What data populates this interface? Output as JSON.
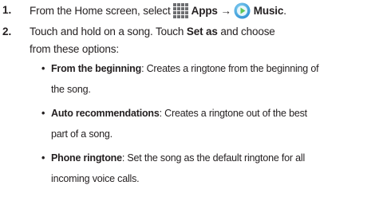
{
  "steps": [
    {
      "number": "1.",
      "text_prefix": "From the Home screen, select",
      "apps_label": "Apps",
      "arrow": "→",
      "music_label": "Music",
      "end_period": ".",
      "icons": [
        "apps-grid-icon",
        "music-app-icon"
      ]
    },
    {
      "number": "2.",
      "line1_prefix": "Touch and hold on a song. Touch",
      "set_as_label": "Set as",
      "line1_suffix": "and choose",
      "line2": "from these options:"
    }
  ],
  "options": [
    {
      "bullet": "•",
      "title": "From the beginning",
      "line1_desc": ": Creates a ringtone from the beginning of",
      "line2_desc": "the song."
    },
    {
      "bullet": "•",
      "title": "Auto recommendations",
      "line1_desc": ": Creates a ringtone out of the best",
      "line2_desc": "part of a song."
    },
    {
      "bullet": "•",
      "title": "Phone ringtone",
      "line1_desc": ": Set the song as the default ringtone for all",
      "line2_desc": "incoming voice calls."
    }
  ],
  "colors": {
    "text": "#231f20",
    "music_icon_outer": "#2c8fd4",
    "music_icon_inner": "#6fd36a"
  }
}
